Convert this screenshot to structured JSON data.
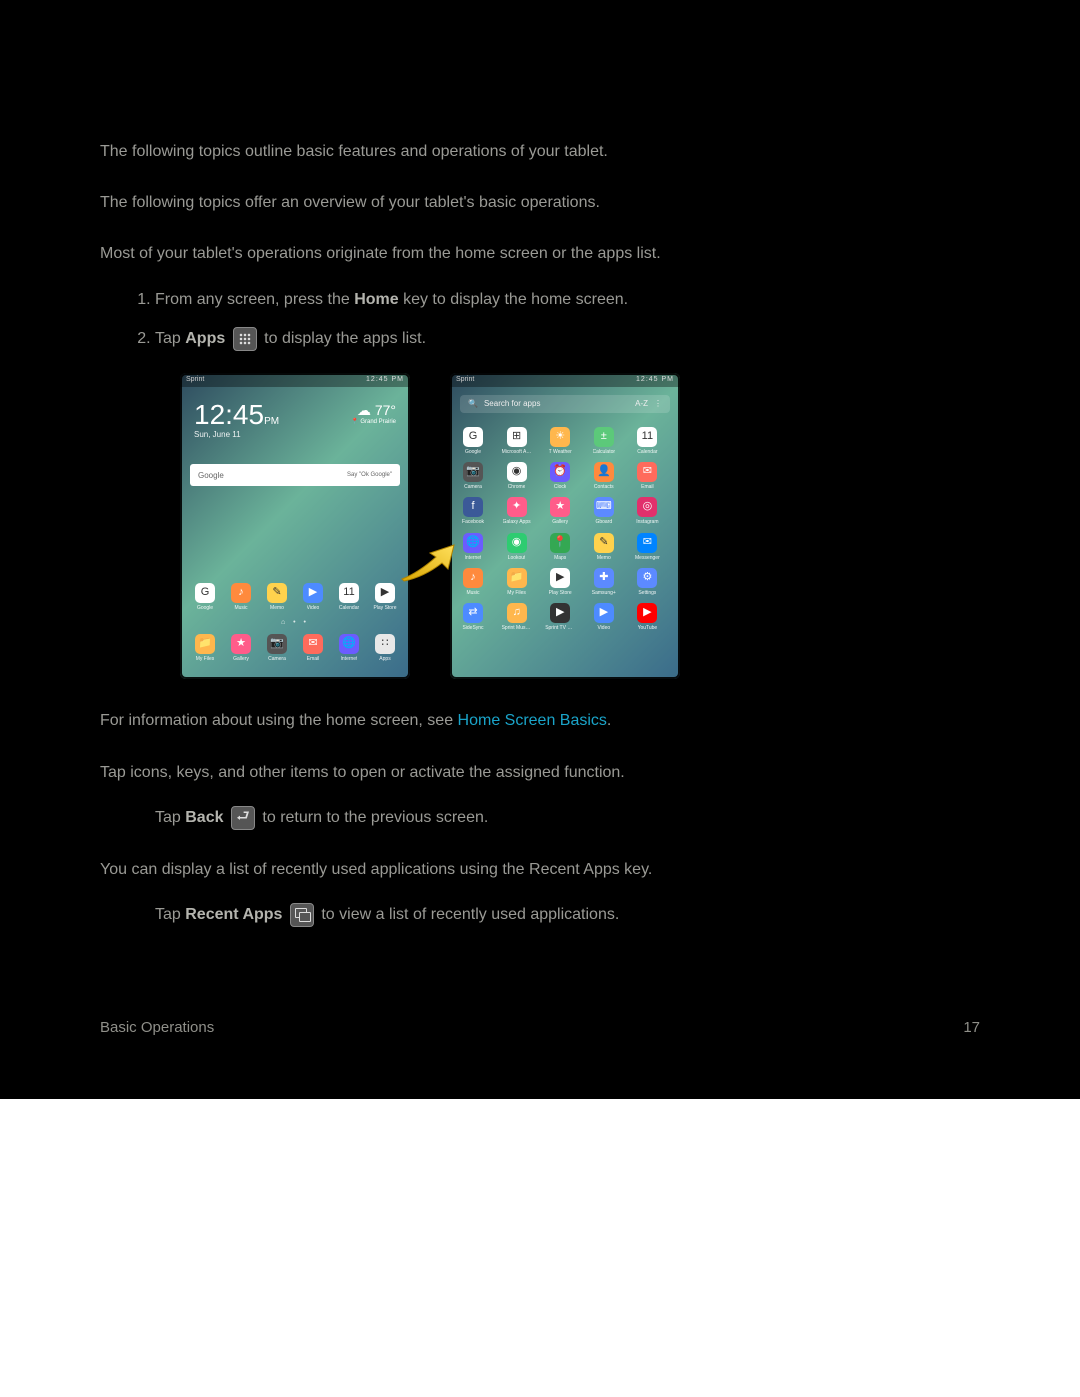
{
  "intro": "The following topics outline basic features and operations of your tablet.",
  "basics_intro": "The following topics offer an overview of your tablet's basic operations.",
  "homescreen_intro": "Most of your tablet's operations originate from the home screen or the apps list.",
  "step1_a": "From any screen, press the ",
  "step1_home": "Home",
  "step1_b": " key to display the home screen.",
  "step2_a": "Tap ",
  "step2_apps": "Apps",
  "step2_b": " to display the apps list.",
  "home_link_pre": "For information about using the home screen, see ",
  "home_link": "Home Screen Basics",
  "home_link_post": ".",
  "select_intro": "Tap icons, keys, and other items to open or activate the assigned function.",
  "select_bullet_a": "Tap ",
  "select_bullet_back": "Back",
  "select_bullet_b": " to return to the previous screen.",
  "recent_intro": "You can display a list of recently used applications using the Recent Apps key.",
  "recent_bullet_a": "Tap ",
  "recent_bullet_label": "Recent Apps",
  "recent_bullet_b": " to view a list of recently used applications.",
  "footer_left": "Basic Operations",
  "footer_right": "17",
  "shot_home": {
    "status_left": "Sprint",
    "status_right": "12:45 PM",
    "clock": "12:45",
    "ampm": "PM",
    "date": "Sun, June 11",
    "temp": "77°",
    "loc": "Grand Prairie",
    "search_left": "Google",
    "search_right": "Say \"Ok Google\"",
    "row1": [
      {
        "l": "Google",
        "c": "#fff",
        "g": "G"
      },
      {
        "l": "Music",
        "c": "#ff8a3d",
        "g": "♪"
      },
      {
        "l": "Memo",
        "c": "#ffd24d",
        "g": "✎"
      },
      {
        "l": "Video",
        "c": "#4d8bff",
        "g": "▶"
      },
      {
        "l": "Calendar",
        "c": "#fff",
        "g": "11"
      },
      {
        "l": "Play Store",
        "c": "#fff",
        "g": "▶"
      }
    ],
    "row2": [
      {
        "l": "My Files",
        "c": "#ffb74d",
        "g": "📁"
      },
      {
        "l": "Gallery",
        "c": "#ff5c8a",
        "g": "★"
      },
      {
        "l": "Camera",
        "c": "#555",
        "g": "📷"
      },
      {
        "l": "Email",
        "c": "#ff6b5c",
        "g": "✉"
      },
      {
        "l": "Internet",
        "c": "#6b5cff",
        "g": "🌐"
      },
      {
        "l": "Apps",
        "c": "#e8e8e8",
        "g": "∷"
      }
    ]
  },
  "shot_apps": {
    "status_left": "Sprint",
    "status_right": "12:45 PM",
    "search": "Search for apps",
    "sort": "A-Z",
    "rows": [
      [
        {
          "l": "Google",
          "c": "#fff",
          "g": "G"
        },
        {
          "l": "Microsoft Apps",
          "c": "#fff",
          "g": "⊞"
        },
        {
          "l": "T Weather",
          "c": "#ffb74d",
          "g": "☀"
        },
        {
          "l": "Calculator",
          "c": "#5cc97a",
          "g": "±"
        },
        {
          "l": "Calendar",
          "c": "#fff",
          "g": "11"
        }
      ],
      [
        {
          "l": "Camera",
          "c": "#555",
          "g": "📷"
        },
        {
          "l": "Chrome",
          "c": "#fff",
          "g": "◉"
        },
        {
          "l": "Clock",
          "c": "#6b5cff",
          "g": "⏰"
        },
        {
          "l": "Contacts",
          "c": "#ff8a3d",
          "g": "👤"
        },
        {
          "l": "Email",
          "c": "#ff6b5c",
          "g": "✉"
        }
      ],
      [
        {
          "l": "Facebook",
          "c": "#3b5998",
          "g": "f"
        },
        {
          "l": "Galaxy Apps",
          "c": "#ff5c8a",
          "g": "✦"
        },
        {
          "l": "Gallery",
          "c": "#ff5c8a",
          "g": "★"
        },
        {
          "l": "Gboard",
          "c": "#5c8aff",
          "g": "⌨"
        },
        {
          "l": "Instagram",
          "c": "#e1306c",
          "g": "◎"
        }
      ],
      [
        {
          "l": "Internet",
          "c": "#6b5cff",
          "g": "🌐"
        },
        {
          "l": "Lookout",
          "c": "#2ecc71",
          "g": "◉"
        },
        {
          "l": "Maps",
          "c": "#34a853",
          "g": "📍"
        },
        {
          "l": "Memo",
          "c": "#ffd24d",
          "g": "✎"
        },
        {
          "l": "Messenger",
          "c": "#0084ff",
          "g": "✉"
        }
      ],
      [
        {
          "l": "Music",
          "c": "#ff8a3d",
          "g": "♪"
        },
        {
          "l": "My Files",
          "c": "#ffb74d",
          "g": "📁"
        },
        {
          "l": "Play Store",
          "c": "#fff",
          "g": "▶"
        },
        {
          "l": "Samsung+",
          "c": "#5c8aff",
          "g": "✚"
        },
        {
          "l": "Settings",
          "c": "#5c8aff",
          "g": "⚙"
        }
      ],
      [
        {
          "l": "SideSync",
          "c": "#4d8bff",
          "g": "⇄"
        },
        {
          "l": "Sprint Music Plus",
          "c": "#ffb74d",
          "g": "♫"
        },
        {
          "l": "Sprint TV & Movies",
          "c": "#333",
          "g": "▶"
        },
        {
          "l": "Video",
          "c": "#4d8bff",
          "g": "▶"
        },
        {
          "l": "YouTube",
          "c": "#ff0000",
          "g": "▶"
        }
      ]
    ]
  }
}
